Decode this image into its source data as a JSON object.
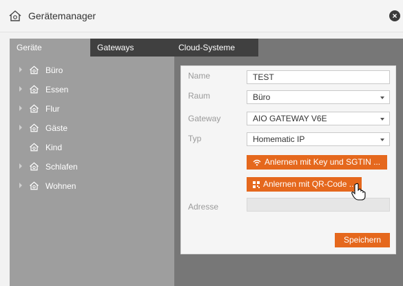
{
  "window": {
    "title": "Gerätemanager",
    "close_label": "×"
  },
  "tabs": [
    {
      "label": "Geräte"
    },
    {
      "label": "Gateways"
    },
    {
      "label": "Cloud-Systeme"
    }
  ],
  "tree": [
    {
      "label": "Büro"
    },
    {
      "label": "Essen"
    },
    {
      "label": "Flur"
    },
    {
      "label": "Gäste"
    },
    {
      "label": "Kind"
    },
    {
      "label": "Schlafen"
    },
    {
      "label": "Wohnen"
    }
  ],
  "form": {
    "name": {
      "label": "Name",
      "value": "TEST"
    },
    "raum": {
      "label": "Raum",
      "value": "Büro"
    },
    "gateway": {
      "label": "Gateway",
      "value": "AIO GATEWAY V6E"
    },
    "typ": {
      "label": "Typ",
      "value": "Homematic IP"
    },
    "learn_key_button": "Anlernen mit Key und SGTIN ...",
    "learn_qr_button": "Anlernen mit QR-Code ...",
    "adresse": {
      "label": "Adresse",
      "value": ""
    },
    "save_button": "Speichern"
  },
  "colors": {
    "accent": "#e5681d",
    "tab_active": "#9e9e9e",
    "tab_inactive": "#404040",
    "sidebar": "#9e9e9e",
    "content_bg": "#777777"
  },
  "icons": {
    "title": "house-icon",
    "room": "house-icon",
    "wifi": "wifi-icon",
    "qr": "qr-code-icon",
    "cursor": "hand-pointer-icon"
  }
}
